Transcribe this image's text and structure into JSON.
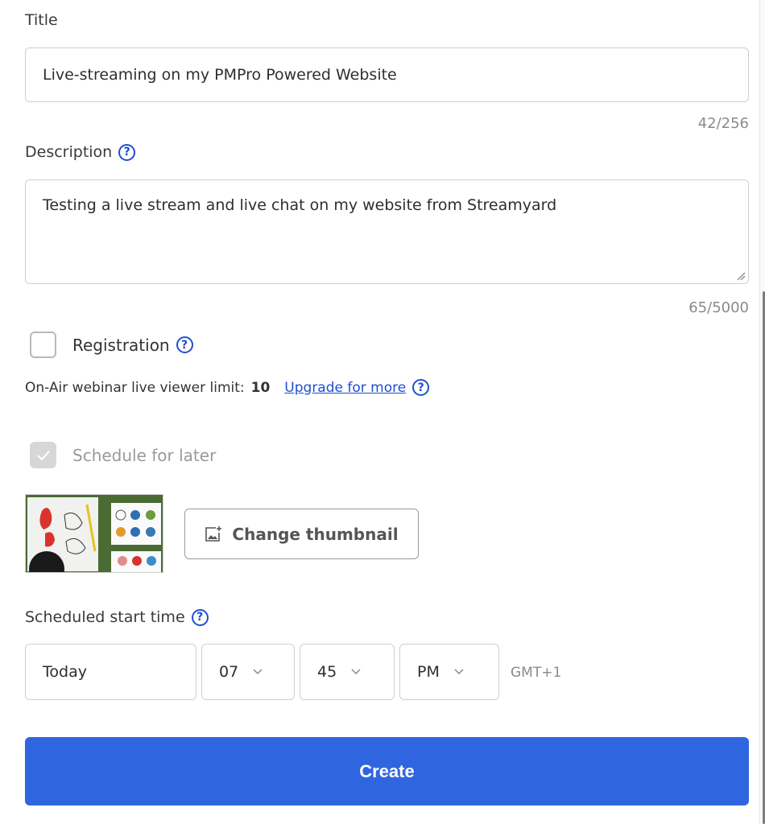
{
  "title_field": {
    "label": "Title",
    "value": "Live-streaming on my PMPro Powered Website",
    "counter": "42/256"
  },
  "description_field": {
    "label": "Description",
    "value": "Testing a live stream and live chat on my website from Streamyard",
    "counter": "65/5000"
  },
  "registration": {
    "label": "Registration",
    "checked": false
  },
  "viewer_limit": {
    "text": "On-Air webinar live viewer limit:",
    "value": "10",
    "upgrade_link": "Upgrade for more"
  },
  "schedule_later": {
    "label": "Schedule for later",
    "checked": true,
    "disabled": true
  },
  "thumbnail": {
    "button_label": "Change thumbnail"
  },
  "schedule": {
    "label": "Scheduled start time",
    "date": "Today",
    "hour": "07",
    "minute": "45",
    "ampm": "PM",
    "timezone": "GMT+1"
  },
  "create_button": {
    "label": "Create"
  },
  "colors": {
    "accent": "#3065e0",
    "help_icon": "#1f4fd1",
    "muted_text": "#8a8a8a"
  }
}
